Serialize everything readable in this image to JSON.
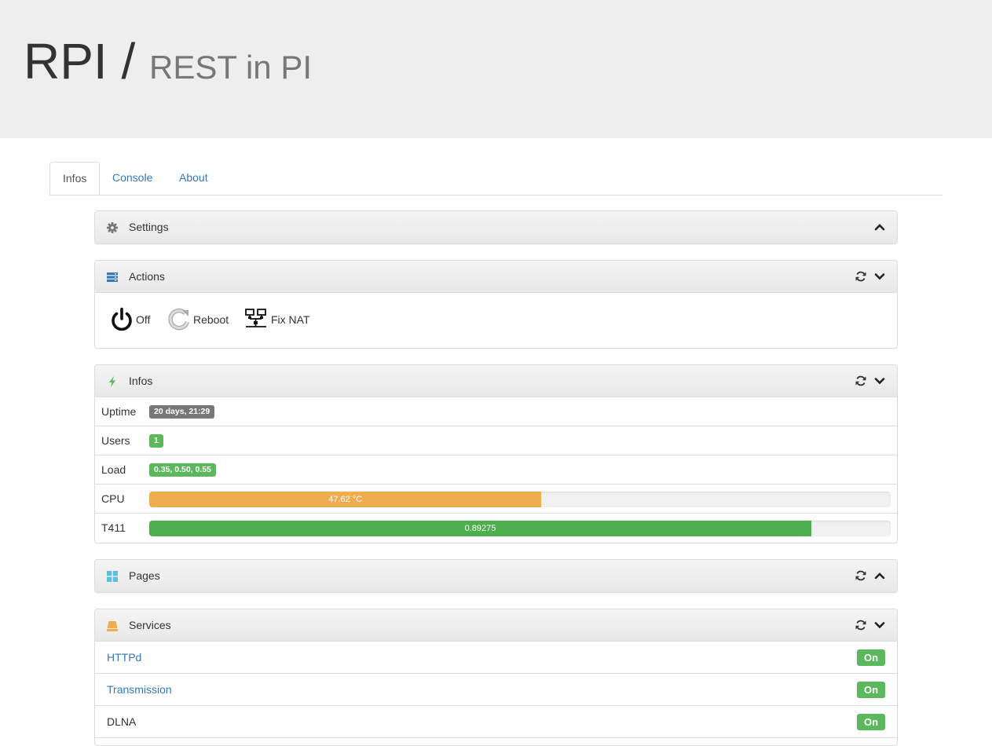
{
  "header": {
    "title": "RPI /",
    "subtitle": "REST in PI"
  },
  "tabs": [
    {
      "label": "Infos",
      "active": true
    },
    {
      "label": "Console",
      "active": false
    },
    {
      "label": "About",
      "active": false
    }
  ],
  "panels": {
    "settings": {
      "title": "Settings",
      "icon": "gear-icon",
      "state": "collapsed"
    },
    "actions": {
      "title": "Actions",
      "icon": "server-icon",
      "items": [
        {
          "label": "Off",
          "icon": "power-icon"
        },
        {
          "label": "Reboot",
          "icon": "reboot-icon"
        },
        {
          "label": "Fix NAT",
          "icon": "network-icon"
        }
      ]
    },
    "infos": {
      "title": "Infos",
      "icon": "bolt-icon",
      "rows": {
        "uptime": {
          "label": "Uptime",
          "value": "20 days, 21:29"
        },
        "users": {
          "label": "Users",
          "value": "1"
        },
        "load": {
          "label": "Load",
          "value": "0.35, 0.50, 0.55"
        },
        "cpu": {
          "label": "CPU",
          "value": "47.62 °C",
          "percent": 52.9
        },
        "t411": {
          "label": "T411",
          "value": "0.89275",
          "percent": 89.3
        }
      }
    },
    "pages": {
      "title": "Pages",
      "icon": "windows-icon",
      "state": "collapsed"
    },
    "services": {
      "title": "Services",
      "icon": "disk-icon",
      "items": [
        {
          "name": "HTTPd",
          "status": "On",
          "link": true
        },
        {
          "name": "Transmission",
          "status": "On",
          "link": true
        },
        {
          "name": "DLNA",
          "status": "On",
          "link": false
        }
      ]
    }
  },
  "colors": {
    "link": "#337ab7",
    "success": "#5cb85c",
    "warning": "#f0ad4e",
    "uptime_badge": "#777777",
    "bolt": "#5cb85c",
    "pages_icon": "#5bc0de",
    "services_icon": "#f0ad4e"
  }
}
